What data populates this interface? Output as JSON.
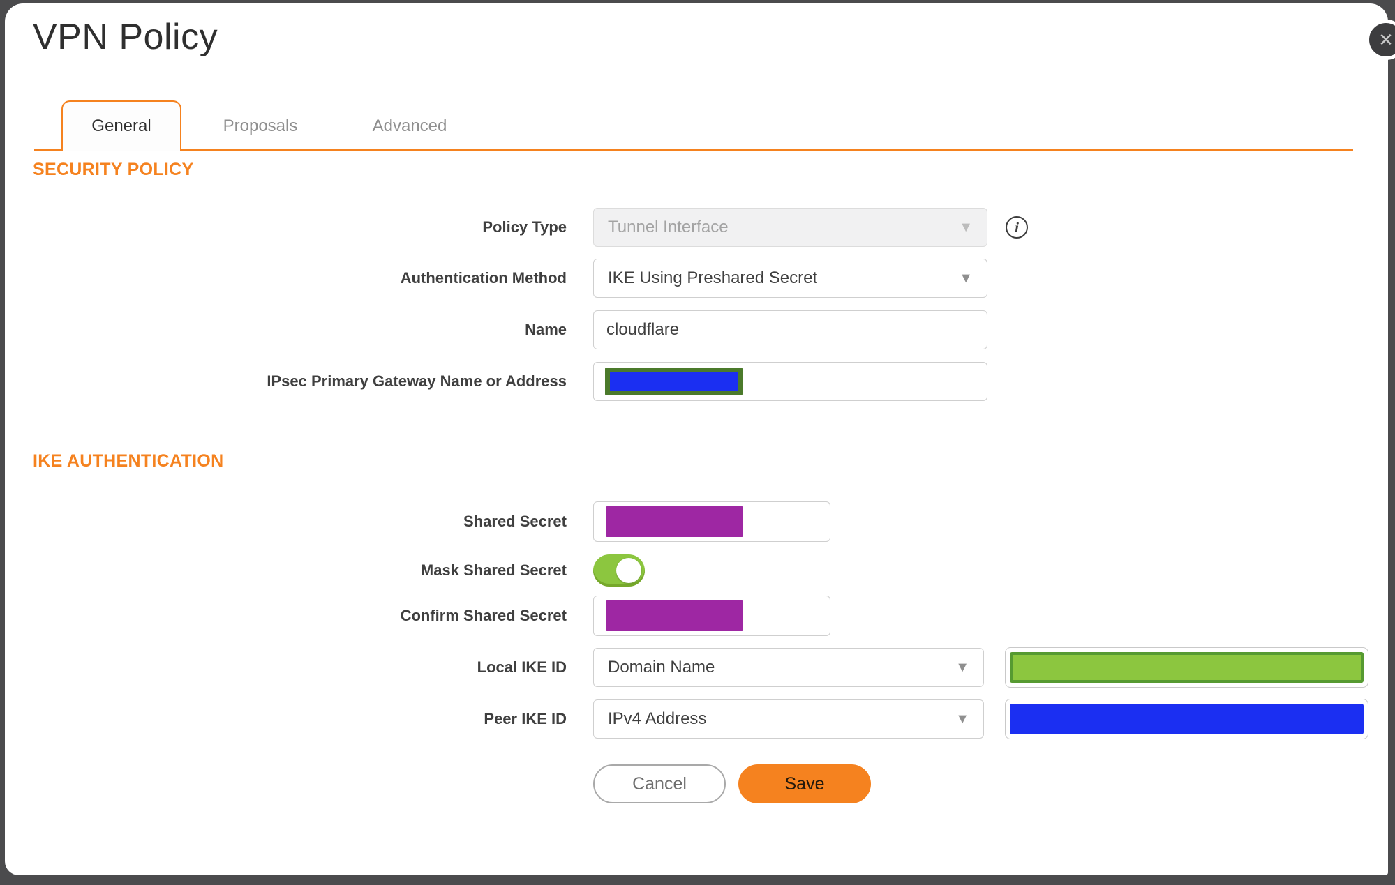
{
  "dialog": {
    "title": "VPN Policy"
  },
  "icons": {
    "close": "✕",
    "info": "i",
    "caret": "▼"
  },
  "tabs": [
    {
      "label": "General",
      "active": true
    },
    {
      "label": "Proposals",
      "active": false
    },
    {
      "label": "Advanced",
      "active": false
    }
  ],
  "security": {
    "heading": "SECURITY POLICY",
    "policy_type_label": "Policy Type",
    "policy_type_value": "Tunnel Interface",
    "policy_type_disabled": true,
    "auth_method_label": "Authentication Method",
    "auth_method_value": "IKE Using Preshared Secret",
    "name_label": "Name",
    "name_value": "cloudflare",
    "gateway_label": "IPsec Primary Gateway Name or Address",
    "gateway_value_redacted": true
  },
  "ike": {
    "heading": "IKE AUTHENTICATION",
    "shared_secret_label": "Shared Secret",
    "shared_secret_redacted": true,
    "mask_shared_secret_label": "Mask Shared Secret",
    "mask_shared_secret_state": "on",
    "confirm_shared_secret_label": "Confirm Shared Secret",
    "confirm_shared_secret_redacted": true,
    "local_ike_id_label": "Local IKE ID",
    "local_ike_id_value": "Domain Name",
    "local_ike_id_value2_redacted": true,
    "peer_ike_id_label": "Peer IKE ID",
    "peer_ike_id_value": "IPv4 Address",
    "peer_ike_id_value2_redacted": true
  },
  "actions": {
    "cancel": "Cancel",
    "save": "Save"
  },
  "colors": {
    "accent_orange": "#F5821F",
    "page_background": "#4B4B4D",
    "redaction_purple": "#9E27A3",
    "redaction_blue": "#1B2FF2",
    "redaction_green_fill": "#8CC63F",
    "redaction_green_border": "#569A31",
    "redaction_olive_border": "#4B7A2B",
    "toggle_on_green": "#8CC63F"
  }
}
